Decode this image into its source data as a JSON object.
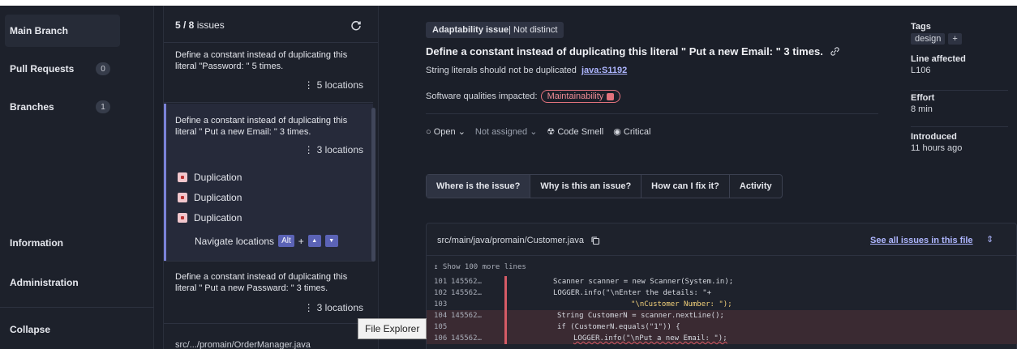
{
  "nav": {
    "items": [
      {
        "label": "Main Branch",
        "count": null
      },
      {
        "label": "Pull Requests",
        "count": "0"
      },
      {
        "label": "Branches",
        "count": "1"
      },
      {
        "label": "Information",
        "count": null
      },
      {
        "label": "Administration",
        "count": null
      },
      {
        "label": "Collapse",
        "count": null
      }
    ]
  },
  "issues": {
    "count_bold": "5 / 8",
    "count_rest": " issues",
    "list": [
      {
        "title": "Define a constant instead of duplicating this literal \"Password: \" 5 times.",
        "locations": "5 locations"
      },
      {
        "title": "Define a constant instead of duplicating this literal \" Put a new Email: \" 3 times.",
        "locations": "3 locations"
      },
      {
        "title": "Define a constant instead of duplicating this literal \" Put a new Passward: \" 3 times.",
        "locations": "3 locations"
      }
    ],
    "duplications": [
      "Duplication",
      "Duplication",
      "Duplication"
    ],
    "navigate_label": "Navigate locations",
    "alt_key": "Alt",
    "plus": "+",
    "bottom_file": "src/.../promain/OrderManager.java"
  },
  "detail": {
    "badge_bold": "Adaptability issue",
    "badge_rest": " | Not distinct",
    "title": "Define a constant instead of duplicating this literal \" Put a new Email: \" 3 times.",
    "rule_text": "String literals should not be duplicated",
    "rule_link": "java:S1192",
    "qualities_label": "Software qualities impacted:",
    "quality": "Maintainability",
    "status": "Open",
    "assignee": "Not assigned",
    "type": "Code Smell",
    "severity": "Critical",
    "tabs": [
      "Where is the issue?",
      "Why is this an issue?",
      "How can I fix it?",
      "Activity"
    ]
  },
  "meta": {
    "tags_label": "Tags",
    "tag": "design",
    "tag_add": "+",
    "line_label": "Line affected",
    "line_value": "L106",
    "effort_label": "Effort",
    "effort_value": "8 min",
    "introduced_label": "Introduced",
    "introduced_value": "11 hours ago"
  },
  "code": {
    "path": "src/main/java/promain/Customer.java",
    "see_all": "See all issues in this file",
    "show_more": "Show 100 more lines",
    "lines": [
      {
        "ln": "101",
        "rev": "145562…",
        "text": "Scanner scanner = new Scanner(System.in);"
      },
      {
        "ln": "102",
        "rev": "145562…",
        "text": "LOGGER.info(\"\\nEnter the details: \"+"
      },
      {
        "ln": "103",
        "rev": "",
        "text": "\"\\nCustomer Number: \");"
      },
      {
        "ln": "104",
        "rev": "145562…",
        "text": "String CustomerN = scanner.nextLine();"
      },
      {
        "ln": "105",
        "rev": "",
        "text": "if (CustomerN.equals(\"1\")) {"
      },
      {
        "ln": "106",
        "rev": "145562…",
        "text": "LOGGER.info(\"\\nPut a new Email: \");"
      }
    ]
  },
  "tooltip": "File Explorer",
  "colors": {
    "accent": "#5b63b6",
    "issue_red": "#d55b66",
    "link": "#aeb6ff"
  }
}
